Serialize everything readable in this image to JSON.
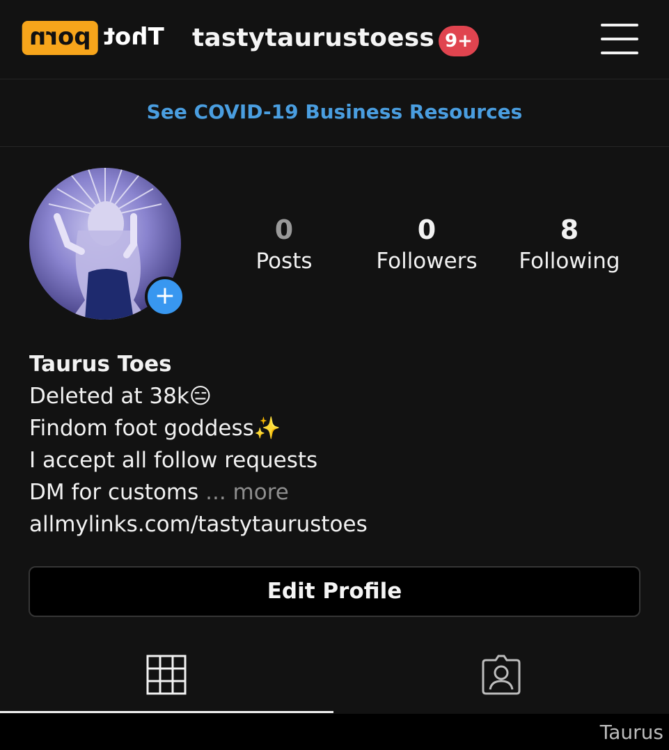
{
  "watermark_logo": {
    "left_text": "Thot",
    "box_text": "porn"
  },
  "header": {
    "username": "tastytaurustoess",
    "notification_badge": "9+"
  },
  "banner": {
    "link_text": "See COVID-19 Business Resources"
  },
  "stats": [
    {
      "value": "0",
      "label": "Posts"
    },
    {
      "value": "0",
      "label": "Followers"
    },
    {
      "value": "8",
      "label": "Following"
    }
  ],
  "bio": {
    "name": "Taurus Toes",
    "line1": "Deleted at 38k😑",
    "line2": "Findom foot goddess✨",
    "line3": "I accept all follow requests",
    "line4": "DM for customs",
    "more": " ... more",
    "link": "allmylinks.com/tastytaurustoes"
  },
  "edit_profile_label": "Edit Profile",
  "footer": {
    "watermark": "Taurus"
  },
  "colors": {
    "accent": "#3897f0",
    "link": "#4a9ee0",
    "badge": "#e0444f",
    "logo_box": "#f7a51b"
  }
}
